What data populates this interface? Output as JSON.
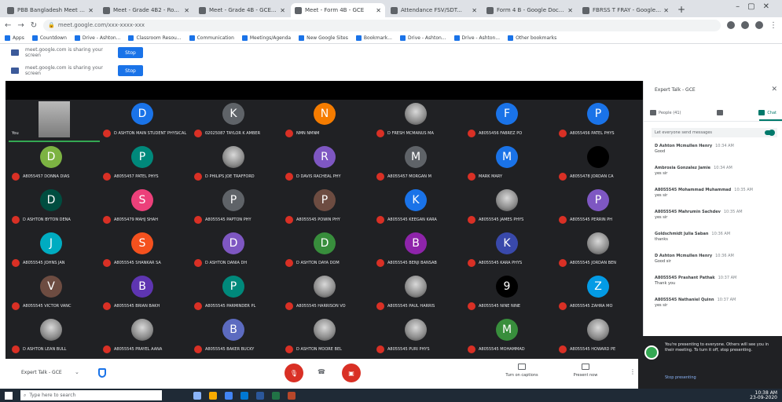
{
  "browser": {
    "tabs": [
      {
        "label": "PBB Bangladesh Meet Intrusion...",
        "active": false
      },
      {
        "label": "Meet - Grade 4B2 - Ro...",
        "active": false
      },
      {
        "label": "Meet - Grade 4B - GCE...",
        "active": false
      },
      {
        "label": "Meet - Form 4B - GCE",
        "active": true
      },
      {
        "label": "Attendance FSV/SDT...",
        "active": false
      },
      {
        "label": "Form 4 B - Google Doc...",
        "active": false
      },
      {
        "label": "FBRSS T FRAY - Google F...",
        "active": false
      }
    ],
    "url": "meet.google.com/xxx-xxxx-xxx",
    "bookmarks": [
      "Apps",
      "Countdown",
      "Drive - Ashton...",
      "Classroom Resou...",
      "Communication",
      "Meetings/Agenda",
      "New Google Sites",
      "Bookmark...",
      "Drive - Ashton...",
      "Drive - Ashton...",
      "Other bookmarks"
    ]
  },
  "infobars": [
    {
      "text": "meet.google.com is sharing your screen",
      "button": "Stop"
    },
    {
      "text": "meet.google.com is sharing your screen",
      "button": "Stop"
    }
  ],
  "self_tile": {
    "name": "You"
  },
  "participants": [
    {
      "initial": "D",
      "color": "#1a73e8",
      "name": "D ASHTON MAIN STUDENT PHYSICAL"
    },
    {
      "initial": "K",
      "color": "#5f6368",
      "name": "02025087 TAYLOR K AMBER"
    },
    {
      "initial": "N",
      "color": "#f57c00",
      "name": "NMN NMNM"
    },
    {
      "initial": "",
      "color": "photo",
      "name": "D FRESH MCMANUS MA"
    },
    {
      "initial": "F",
      "color": "#1a73e8",
      "name": "A8055456 FABREZ PO"
    },
    {
      "initial": "P",
      "color": "#1a73e8",
      "name": "A8055456 PATEL PHYS"
    },
    {
      "initial": "D",
      "color": "#7cb342",
      "name": "A8055457 DONNA DIAS"
    },
    {
      "initial": "P",
      "color": "#00897b",
      "name": "A8055457 PATEL PHYS"
    },
    {
      "initial": "",
      "color": "photo",
      "name": "D PHILIPS JOE TRAFFORD"
    },
    {
      "initial": "R",
      "color": "#7e57c2",
      "name": "D DAVIS RACHEAL PHY"
    },
    {
      "initial": "M",
      "color": "#5f6368",
      "name": "A8055457 MORGAN M"
    },
    {
      "initial": "M",
      "color": "#1a73e8",
      "name": "MARK MARY"
    },
    {
      "initial": "",
      "color": "dark",
      "name": "A8055478 JORDAN CA"
    },
    {
      "initial": "D",
      "color": "#004d40",
      "name": "D ASHTON BYTON DENA"
    },
    {
      "initial": "S",
      "color": "#ec407a",
      "name": "A8055479 MAHJ SHAH"
    },
    {
      "initial": "P",
      "color": "#5f6368",
      "name": "A8055545 PAPTON PHY"
    },
    {
      "initial": "P",
      "color": "#6d4c41",
      "name": "A8055545 POWIN PHY"
    },
    {
      "initial": "K",
      "color": "#1a73e8",
      "name": "A8055545 KEEGAN KARA"
    },
    {
      "initial": "",
      "color": "photo",
      "name": "A8055545 JAMES PHYS"
    },
    {
      "initial": "P",
      "color": "#7e57c2",
      "name": "A8055545 PERRIN PH"
    },
    {
      "initial": "J",
      "color": "#00acc1",
      "name": "A8055545 JOHNS JAN"
    },
    {
      "initial": "S",
      "color": "#f4511e",
      "name": "A8055545 SHANKAR SA"
    },
    {
      "initial": "D",
      "color": "#7e57c2",
      "name": "D ASHTON DANIA DH"
    },
    {
      "initial": "D",
      "color": "#388e3c",
      "name": "D ASHTON DAYA DOM"
    },
    {
      "initial": "B",
      "color": "#8e24aa",
      "name": "A8055545 BENJI BANSAB"
    },
    {
      "initial": "K",
      "color": "#3949ab",
      "name": "A8055545 KARA PHYS"
    },
    {
      "initial": "",
      "color": "photo",
      "name": "A8055545 JORDAN BEN"
    },
    {
      "initial": "V",
      "color": "#6d4c41",
      "name": "A8055545 VICTOR VANC"
    },
    {
      "initial": "B",
      "color": "#5e35b1",
      "name": "A8055545 BRIAN BAKH"
    },
    {
      "initial": "P",
      "color": "#00897b",
      "name": "A8055545 PARMINDER PL"
    },
    {
      "initial": "",
      "color": "photo",
      "name": "A8055545 HARRISON VO"
    },
    {
      "initial": "",
      "color": "photo",
      "name": "A8055545 PAUL HARRIS"
    },
    {
      "initial": "9",
      "color": "#000000",
      "name": "A8055545 NINE NINE"
    },
    {
      "initial": "Z",
      "color": "#039be5",
      "name": "A8055545 ZAHRA MO"
    },
    {
      "initial": "",
      "color": "photo",
      "name": "D ASHTON LEAN BULL"
    },
    {
      "initial": "",
      "color": "photo",
      "name": "A8055545 PRAYEL AANA"
    },
    {
      "initial": "B",
      "color": "#5c6bc0",
      "name": "A8055545 BAKER BUCKY"
    },
    {
      "initial": "",
      "color": "photo",
      "name": "D ASHTON MOORE BEL"
    },
    {
      "initial": "",
      "color": "photo",
      "name": "A8055545 PURI PHYS"
    },
    {
      "initial": "M",
      "color": "#388e3c",
      "name": "A8055545 MOHAMMAD"
    },
    {
      "initial": "",
      "color": "photo",
      "name": "A8055545 HOWARD PE"
    }
  ],
  "panel": {
    "title": "Expert Talk - GCE",
    "tabs": [
      "People (41)",
      "",
      "Chat"
    ],
    "toggle_label": "Let everyone send messages",
    "messages": [
      {
        "name": "D Ashton Mcmullen Henry",
        "time": "10:34 AM",
        "text": "Good"
      },
      {
        "name": "Ambrosia Gonzalez Jamie",
        "time": "10:34 AM",
        "text": "yes sir"
      },
      {
        "name": "A8055545 Mohammad Muhammad",
        "time": "10:35 AM",
        "text": "yes sir"
      },
      {
        "name": "A8055545 Mahrumin Sachdev",
        "time": "10:35 AM",
        "text": "yes sir"
      },
      {
        "name": "Goldschmidt Julia Saban",
        "time": "10:36 AM",
        "text": "thanks"
      },
      {
        "name": "D Ashton Mcmullen Henry",
        "time": "10:36 AM",
        "text": "Good sir"
      },
      {
        "name": "A8055545 Prashant Pathak",
        "time": "10:37 AM",
        "text": "Thank you"
      },
      {
        "name": "A8055545 Nathaniel Quinn",
        "time": "10:37 AM",
        "text": "yes sir"
      }
    ]
  },
  "popup": {
    "text": "You're presenting to everyone. Others will see you in their meeting. To turn it off, stop presenting.",
    "button": "Stop presenting"
  },
  "controls": {
    "meeting_name": "Expert Talk - GCE",
    "mic_label": "mic",
    "cam_label": "cam",
    "present_label": "Turn on captions",
    "present_now_label": "Present now",
    "more": "⋮"
  },
  "taskbar": {
    "search_placeholder": "Type here to search",
    "time": "10:38 AM",
    "date": "23-09-2020"
  }
}
